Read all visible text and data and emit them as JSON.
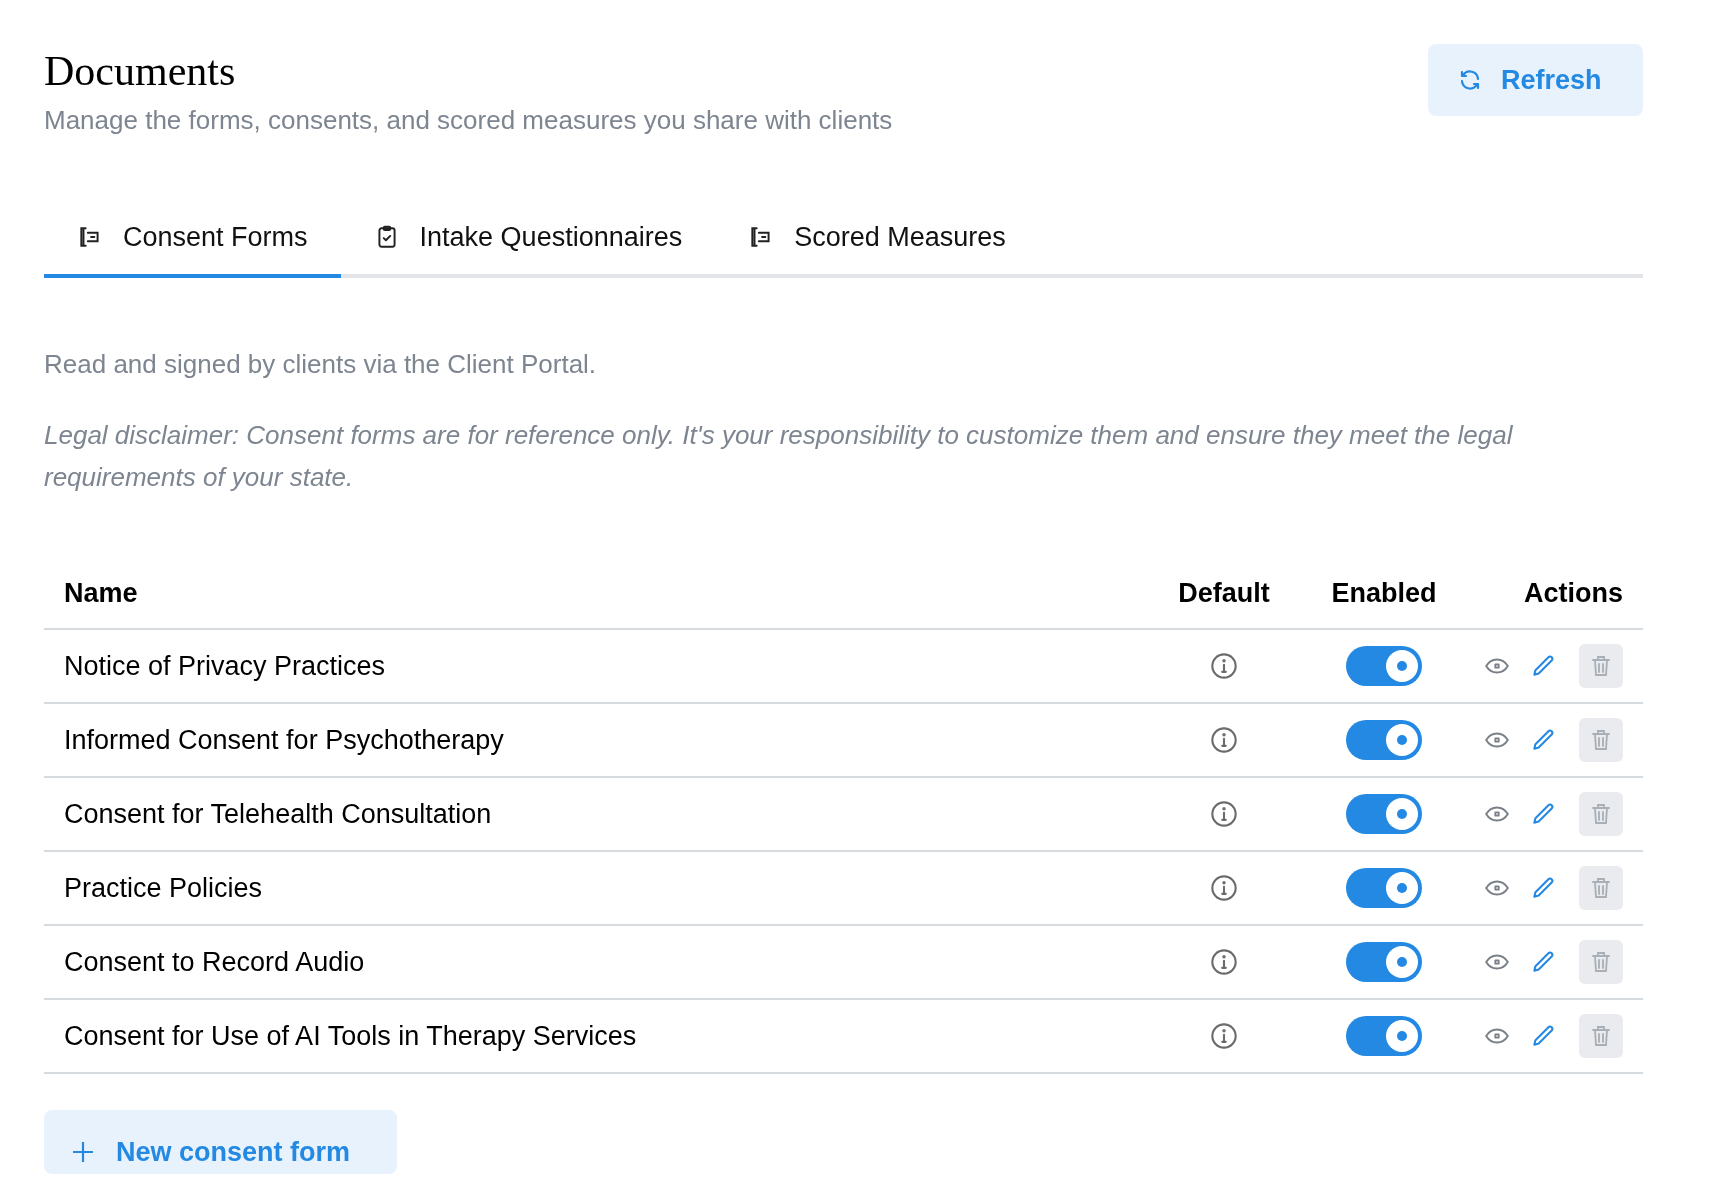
{
  "page": {
    "title": "Documents",
    "subtitle": "Manage the forms, consents, and scored measures you share with clients"
  },
  "refresh_button": {
    "label": "Refresh"
  },
  "tabs": [
    {
      "label": "Consent Forms",
      "selected": true
    },
    {
      "label": "Intake Questionnaires",
      "selected": false
    },
    {
      "label": "Scored Measures",
      "selected": false
    }
  ],
  "description": "Read and signed by clients via the Client Portal.",
  "disclaimer": "Legal disclaimer: Consent forms are for reference only. It's your responsibility to customize them and ensure they meet the legal requirements of your state.",
  "table": {
    "columns": [
      "Name",
      "Default",
      "Enabled",
      "Actions"
    ],
    "rows": [
      {
        "name": "Notice of Privacy Practices",
        "enabled": true
      },
      {
        "name": "Informed Consent for Psychotherapy",
        "enabled": true
      },
      {
        "name": "Consent for Telehealth Consultation",
        "enabled": true
      },
      {
        "name": "Practice Policies",
        "enabled": true
      },
      {
        "name": "Consent to Record Audio",
        "enabled": true
      },
      {
        "name": "Consent for Use of AI Tools in Therapy Services",
        "enabled": true
      }
    ]
  },
  "new_button": {
    "label": "New consent form"
  }
}
